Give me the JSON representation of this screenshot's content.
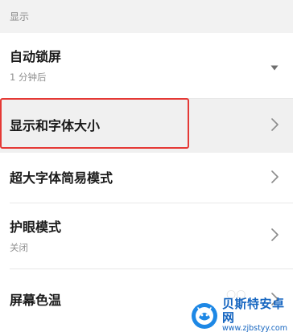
{
  "section": {
    "header": "显示"
  },
  "rows": {
    "auto_lock": {
      "title": "自动锁屏",
      "subtitle": "1 分钟后",
      "icon": "dropdown-triangle-icon"
    },
    "display_font_size": {
      "title": "显示和字体大小",
      "icon": "chevron-right-icon"
    },
    "extra_large_font": {
      "title": "超大字体简易模式",
      "icon": "chevron-right-icon"
    },
    "eye_protection": {
      "title": "护眼模式",
      "subtitle": "关闭",
      "icon": "chevron-right-icon"
    },
    "screen_color_temp": {
      "title": "屏幕色温",
      "icon": "chevron-right-icon"
    }
  },
  "annotation": {
    "highlight_color": "#e53935"
  },
  "watermark": {
    "title": "贝斯特安卓网",
    "url": "www.zjbstyy.com",
    "color": "#1565c0"
  }
}
